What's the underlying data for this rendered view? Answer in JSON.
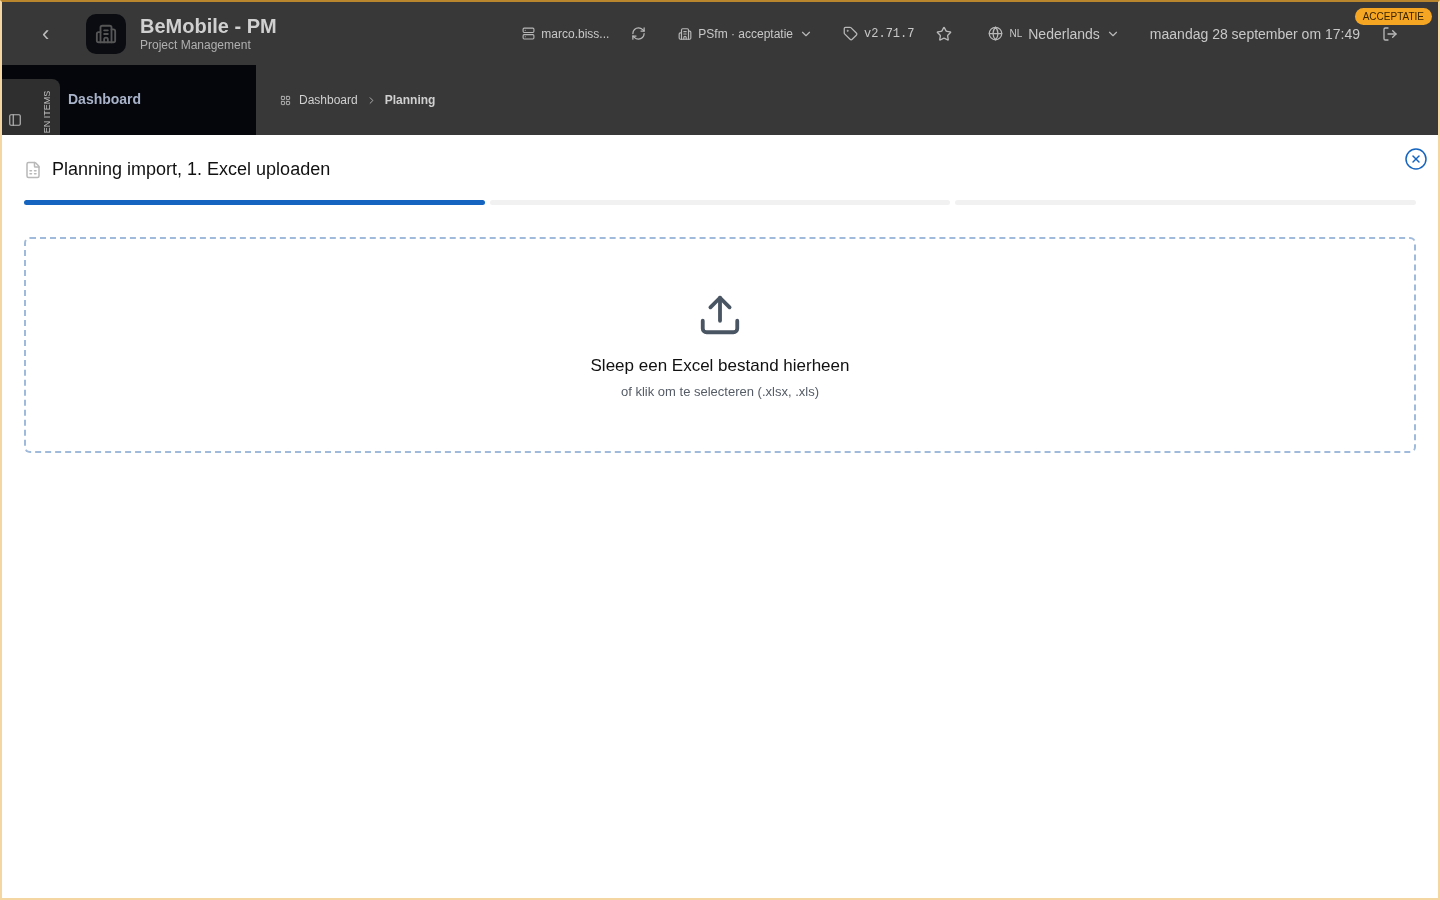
{
  "header": {
    "back": "‹",
    "app_title": "BeMobile - PM",
    "app_subtitle": "Project Management",
    "user": "marco.biss...",
    "environment": "PSfm · acceptatie",
    "version": "v2.71.7",
    "language_code": "NL",
    "language": "Nederlands",
    "datetime": "maandag 28 september om 17:49",
    "env_badge": "ACCEPTATIE"
  },
  "sidebar": {
    "tab_label": "EN ITEMS",
    "item": "Dashboard"
  },
  "breadcrumb": [
    {
      "label": "Dashboard",
      "selected": false
    },
    {
      "label": "Planning",
      "selected": true
    }
  ],
  "modal": {
    "title": "Planning import, 1. Excel uploaden",
    "steps": [
      {
        "done": true
      },
      {
        "done": false
      },
      {
        "done": false
      }
    ],
    "dropzone": {
      "title": "Sleep een Excel bestand hierheen",
      "hint": "of klik om te selecteren (.xlsx, .xls)"
    }
  }
}
